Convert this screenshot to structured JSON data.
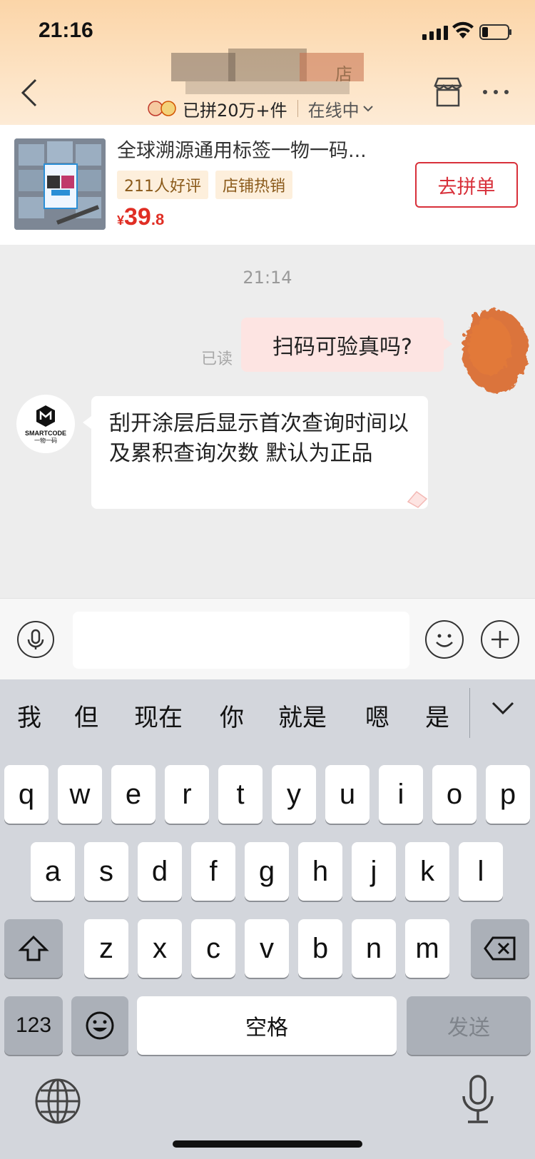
{
  "status_bar": {
    "time": "21:16"
  },
  "header": {
    "subtitle_sold": "已拼20万+件",
    "subtitle_status": "在线中",
    "shop_name_suffix": "店"
  },
  "product": {
    "title": "全球溯源通用标签一物一码...",
    "tags": [
      "211人好评",
      "店铺热销"
    ],
    "price_symbol": "¥",
    "price_int": "39",
    "price_dec": ".8",
    "buy_label": "去拼单"
  },
  "chat": {
    "timestamp": "21:14",
    "read_label": "已读",
    "messages": [
      {
        "from": "self",
        "text": "扫码可验真吗?"
      },
      {
        "from": "shop",
        "text": "刮开涂层后显示首次查询时间以及累积查询次数 默认为正品"
      }
    ],
    "shop_logo_text": "SMARTCODE",
    "shop_logo_sub": "一物一码"
  },
  "input_bar": {
    "value": "",
    "placeholder": ""
  },
  "keyboard": {
    "candidates": [
      "我",
      "但",
      "现在",
      "你",
      "就是",
      "嗯",
      "是"
    ],
    "row1": [
      "q",
      "w",
      "e",
      "r",
      "t",
      "y",
      "u",
      "i",
      "o",
      "p"
    ],
    "row2": [
      "a",
      "s",
      "d",
      "f",
      "g",
      "h",
      "j",
      "k",
      "l"
    ],
    "row3": [
      "z",
      "x",
      "c",
      "v",
      "b",
      "n",
      "m"
    ],
    "numbers_label": "123",
    "space_label": "空格",
    "send_label": "发送"
  },
  "colors": {
    "accent_red": "#e02e24",
    "header_gradient": "#fbd5a8",
    "bubble_out": "#fde4e2"
  }
}
